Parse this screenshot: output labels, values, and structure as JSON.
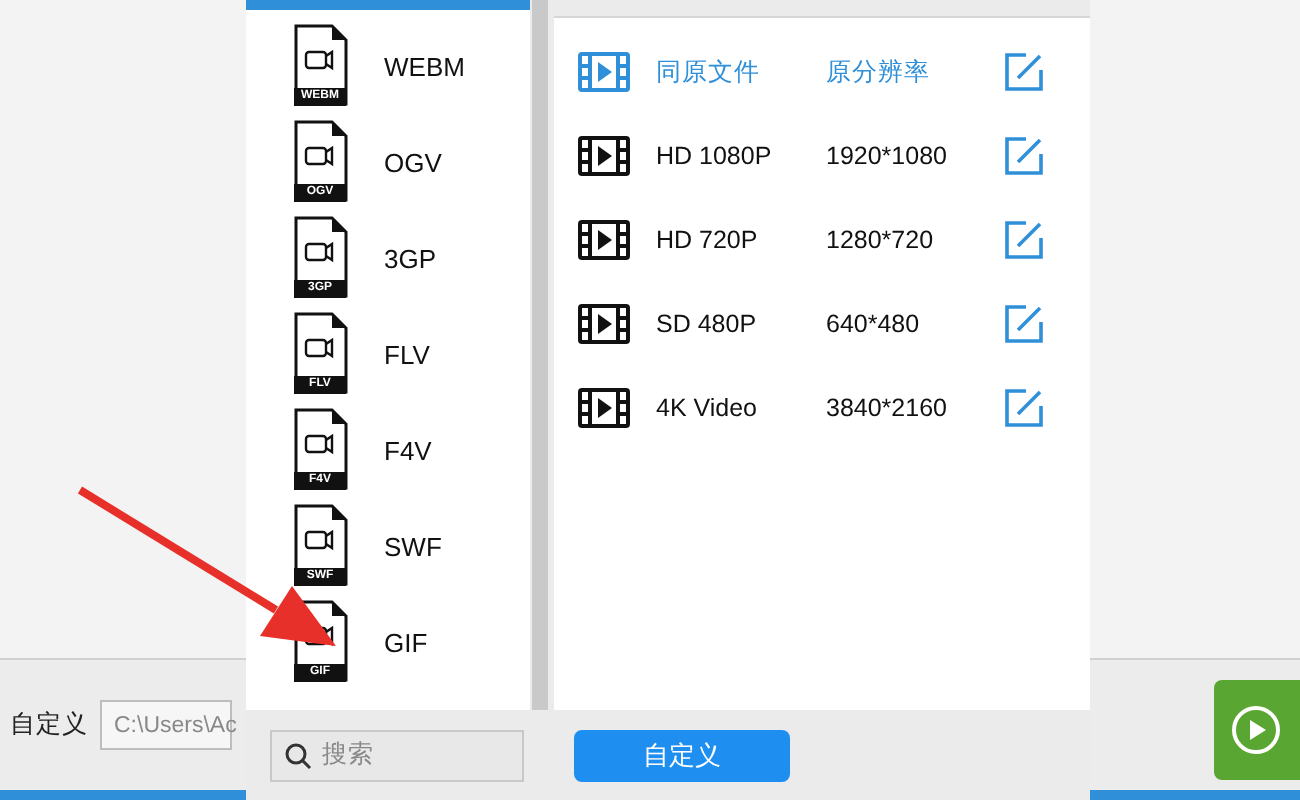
{
  "background": {
    "label": "自定义",
    "path_field": "C:\\Users\\Ac"
  },
  "formats": [
    {
      "name": "WEBM",
      "badge": "WEBM"
    },
    {
      "name": "OGV",
      "badge": "OGV"
    },
    {
      "name": "3GP",
      "badge": "3GP"
    },
    {
      "name": "FLV",
      "badge": "FLV"
    },
    {
      "name": "F4V",
      "badge": "F4V"
    },
    {
      "name": "SWF",
      "badge": "SWF"
    },
    {
      "name": "GIF",
      "badge": "GIF"
    }
  ],
  "presets": [
    {
      "name": "同原文件",
      "resolution": "原分辨率",
      "selected": true
    },
    {
      "name": "HD 1080P",
      "resolution": "1920*1080",
      "selected": false
    },
    {
      "name": "HD 720P",
      "resolution": "1280*720",
      "selected": false
    },
    {
      "name": "SD 480P",
      "resolution": "640*480",
      "selected": false
    },
    {
      "name": "4K Video",
      "resolution": "3840*2160",
      "selected": false
    }
  ],
  "search": {
    "placeholder": "搜索"
  },
  "custom_button": "自定义"
}
